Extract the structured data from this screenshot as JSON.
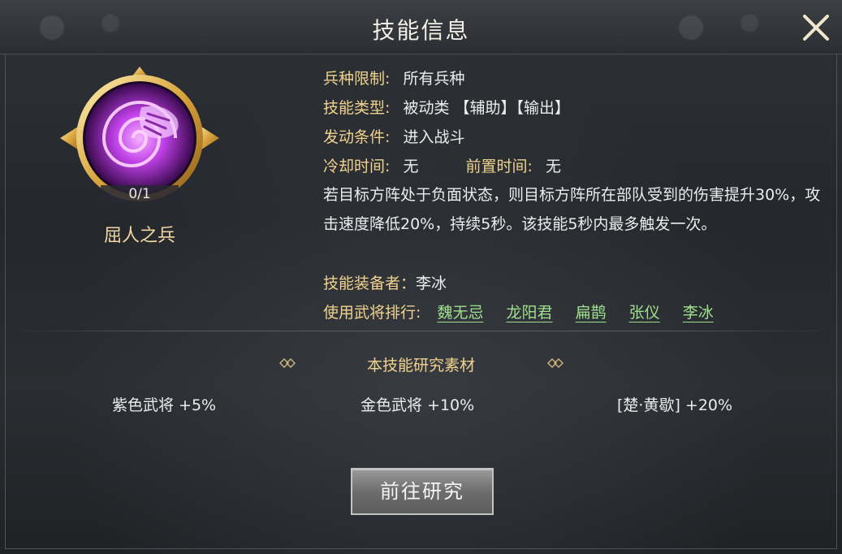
{
  "dialog": {
    "title": "技能信息",
    "close_icon": "close-icon"
  },
  "skill": {
    "icon": "purple-spiral-hand-icon",
    "level": "0/1",
    "name": "屈人之兵",
    "accent_color": "#c040e8"
  },
  "info": {
    "troop_label": "兵种限制:",
    "troop_value": "所有兵种",
    "type_label": "技能类型:",
    "type_value": "被动类 【辅助】【输出】",
    "trigger_label": "发动条件:",
    "trigger_value": "进入战斗",
    "cooldown_label": "冷却时间:",
    "cooldown_value": "无",
    "precast_label": "前置时间:",
    "precast_value": "无",
    "description": "若目标方阵处于负面状态，则目标方阵所在部队受到的伤害提升30%，攻击速度降低20%，持续5秒。该技能5秒内最多触发一次。",
    "equipped_label": "技能装备者：",
    "equipped_value": "李冰",
    "ranking_label": "使用武将排行:",
    "ranking": [
      "魏无忌",
      "龙阳君",
      "扁鹊",
      "张仪",
      "李冰"
    ]
  },
  "research": {
    "title": "本技能研究素材",
    "materials": [
      "紫色武将 +5%",
      "金色武将 +10%",
      "[楚·黄歇] +20%"
    ],
    "button_label": "前往研究"
  }
}
